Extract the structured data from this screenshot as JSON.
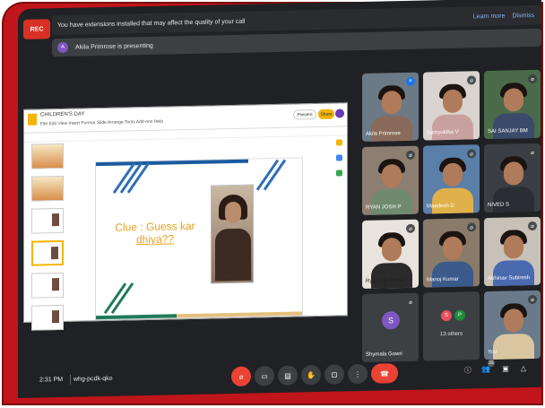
{
  "recording": {
    "label": "REC"
  },
  "notice": {
    "message": "You have extensions installed that may affect the quality of your call",
    "learn_more": "Learn more",
    "dismiss": "Dismiss"
  },
  "presenting": {
    "avatar_initial": "A",
    "text": "Akila Primrose is presenting"
  },
  "slides": {
    "doc_title": "CHILDREN'S DAY",
    "menu": "File  Edit  View  Insert  Format  Slide  Arrange  Tools  Add-ons  Help",
    "present_label": "Present",
    "share_label": "Share",
    "slide_text_line1": "Clue : Guess kar",
    "slide_text_line2": "dhiya??"
  },
  "participants": [
    {
      "name": "Akila Primrose",
      "muted": false
    },
    {
      "name": "Samyuktha V",
      "muted": true
    },
    {
      "name": "SAI SANJAY BM",
      "muted": true
    },
    {
      "name": "RYAN JOSH P",
      "muted": true
    },
    {
      "name": "Maadesh D",
      "muted": true
    },
    {
      "name": "NIVED S",
      "muted": true
    },
    {
      "name": "Ryan Siju Kurian",
      "muted": true
    },
    {
      "name": "Manoj Kumar",
      "muted": true
    },
    {
      "name": "Abhinav Subiresh",
      "muted": true
    },
    {
      "name": "Shymala Gowri",
      "initial": "S",
      "muted": true
    },
    {
      "name": "13 others",
      "initials": [
        "S",
        "P"
      ]
    },
    {
      "name": "You",
      "muted": true
    }
  ],
  "bottom": {
    "time": "2:31 PM",
    "meeting_code": "whg-pcdk-qko",
    "participants_count": "25"
  },
  "colors": {
    "accent": "#1a73e8",
    "danger": "#ea4335",
    "frame": "#c0151a"
  }
}
